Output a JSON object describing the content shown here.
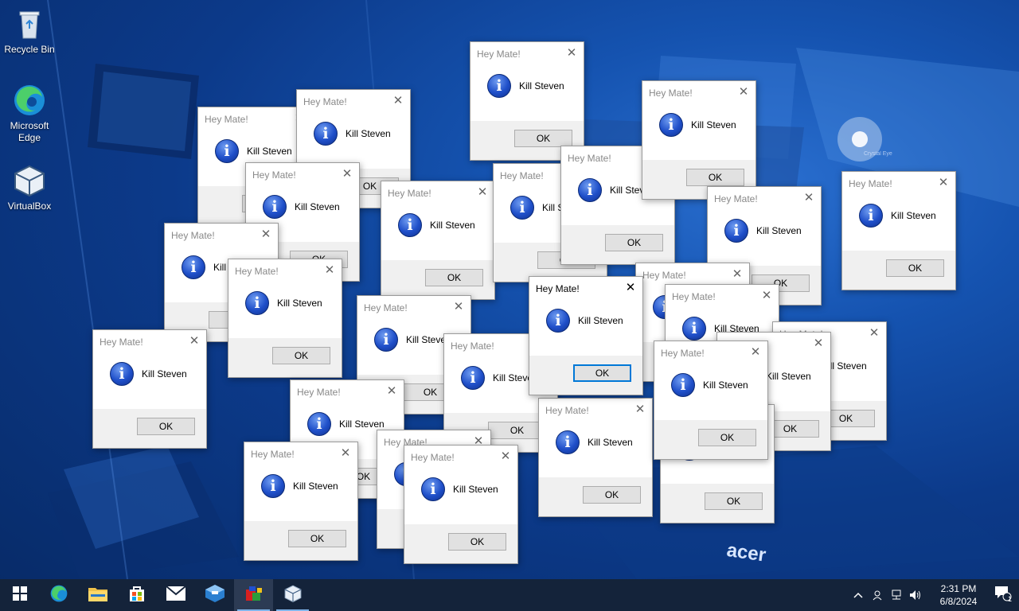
{
  "desktop": {
    "icons": [
      {
        "label": "Recycle Bin"
      },
      {
        "label": "Microsoft Edge"
      },
      {
        "label": "VirtualBox"
      }
    ],
    "wallpaper": {
      "brand_text": "acer",
      "crystal_text": "Crystal Eye"
    }
  },
  "dialog": {
    "title": "Hey Mate!",
    "message": "Kill Steven",
    "ok_label": "OK",
    "close_glyph": "✕"
  },
  "taskbar": {
    "pinned": [
      {
        "name": "start-button",
        "icon": "windows-logo-icon"
      },
      {
        "name": "edge-taskbar-button",
        "icon": "edge-icon"
      },
      {
        "name": "file-explorer-taskbar-button",
        "icon": "folder-icon"
      },
      {
        "name": "store-taskbar-button",
        "icon": "store-icon"
      },
      {
        "name": "mail-taskbar-button",
        "icon": "mail-icon"
      },
      {
        "name": "virtualbox-app-taskbar-button",
        "icon": "box-icon"
      },
      {
        "name": "active-app-taskbar-button",
        "icon": "colorful-app-icon"
      },
      {
        "name": "virtualbox-taskbar-button",
        "icon": "virtualbox-icon"
      }
    ],
    "clock": {
      "time": "2:31 PM",
      "date": "6/8/2024"
    },
    "notification_count": "1"
  },
  "colors": {
    "accent": "#0078d7",
    "taskbar": "#14233a",
    "info_icon": "#1f4fc9"
  }
}
